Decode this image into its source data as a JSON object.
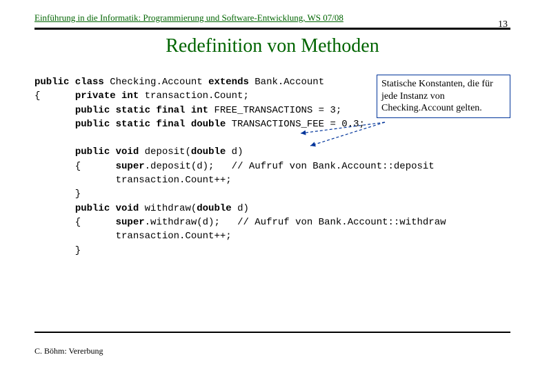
{
  "header": {
    "course_line": "Einführung in die Informatik: Programmierung und Software-Entwicklung, WS 07/08",
    "page_number": "13"
  },
  "title": "Redefinition von Methoden",
  "callout": {
    "text": "Statische Konstanten, die für jede Instanz von Checking.Account gelten."
  },
  "code": {
    "l1a": "public class",
    "l1b": " Checking.Account ",
    "l1c": "extends",
    "l1d": " Bank.Account",
    "l2a": "{      ",
    "l2b": "private int",
    "l2c": " transaction.Count;",
    "l3a": "       ",
    "l3b": "public static final int",
    "l3c": " FREE_TRANSACTIONS = 3;",
    "l4a": "       ",
    "l4b": "public static final double",
    "l4c": " TRANSACTIONS_FEE = 0.3;",
    "blank1": " ",
    "l5a": "       ",
    "l5b": "public void",
    "l5c": " deposit(",
    "l5d": "double",
    "l5e": " d)",
    "l6a": "       {      ",
    "l6b": "super",
    "l6c": ".deposit(d);   // Aufruf von Bank.Account::deposit",
    "l7": "              transaction.Count++;",
    "l8": "       }",
    "l9a": "       ",
    "l9b": "public void",
    "l9c": " withdraw(",
    "l9d": "double",
    "l9e": " d)",
    "l10a": "       {      ",
    "l10b": "super",
    "l10c": ".withdraw(d);   // Aufruf von Bank.Account::withdraw",
    "l11": "              transaction.Count++;",
    "l12": "       }"
  },
  "footer": {
    "text": "C. Böhm: Vererbung"
  }
}
